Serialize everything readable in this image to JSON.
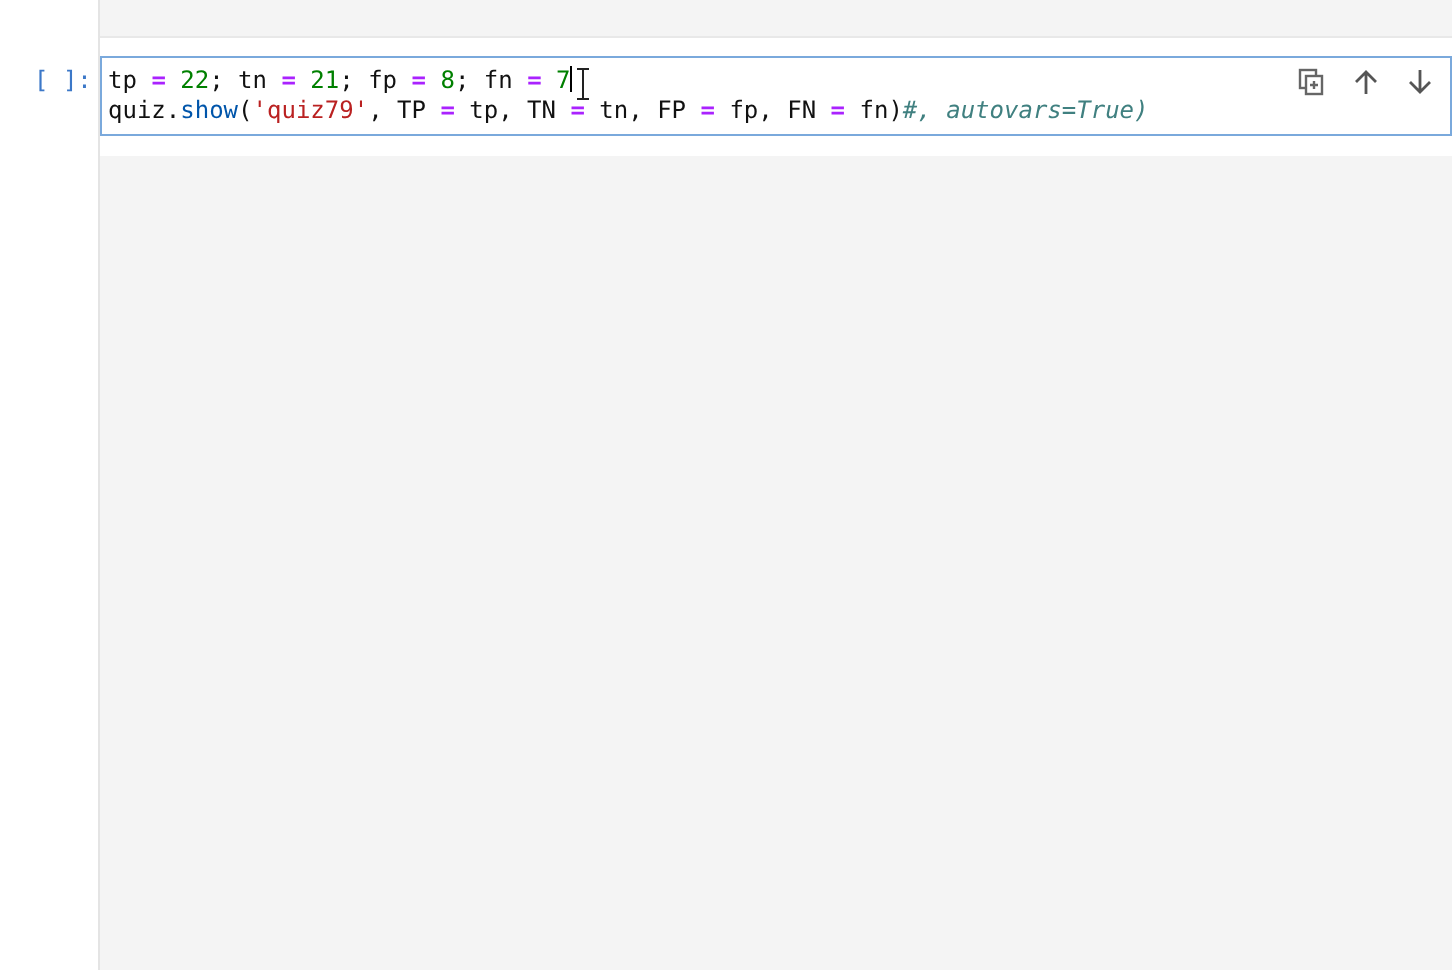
{
  "cell": {
    "prompt": "[ ]:",
    "selected": true,
    "lines": [
      [
        {
          "text": "tp ",
          "kind": "plain"
        },
        {
          "text": "= ",
          "kind": "op"
        },
        {
          "text": "22",
          "kind": "num"
        },
        {
          "text": "; tn ",
          "kind": "plain"
        },
        {
          "text": "= ",
          "kind": "op"
        },
        {
          "text": "21",
          "kind": "num"
        },
        {
          "text": "; fp ",
          "kind": "plain"
        },
        {
          "text": "= ",
          "kind": "op"
        },
        {
          "text": "8",
          "kind": "num"
        },
        {
          "text": "; fn ",
          "kind": "plain"
        },
        {
          "text": "= ",
          "kind": "op"
        },
        {
          "text": "7",
          "kind": "num"
        }
      ],
      [
        {
          "text": "quiz.",
          "kind": "plain"
        },
        {
          "text": "show",
          "kind": "builtin"
        },
        {
          "text": "(",
          "kind": "plain"
        },
        {
          "text": "'quiz79'",
          "kind": "str"
        },
        {
          "text": ", TP ",
          "kind": "plain"
        },
        {
          "text": "=",
          "kind": "op"
        },
        {
          "text": " tp, TN ",
          "kind": "plain"
        },
        {
          "text": "=",
          "kind": "op"
        },
        {
          "text": " tn, FP ",
          "kind": "plain"
        },
        {
          "text": "=",
          "kind": "op"
        },
        {
          "text": " fp, FN ",
          "kind": "plain"
        },
        {
          "text": "=",
          "kind": "op"
        },
        {
          "text": " fn)",
          "kind": "plain"
        },
        {
          "text": "#, autovars=True)",
          "kind": "comment"
        }
      ]
    ]
  }
}
